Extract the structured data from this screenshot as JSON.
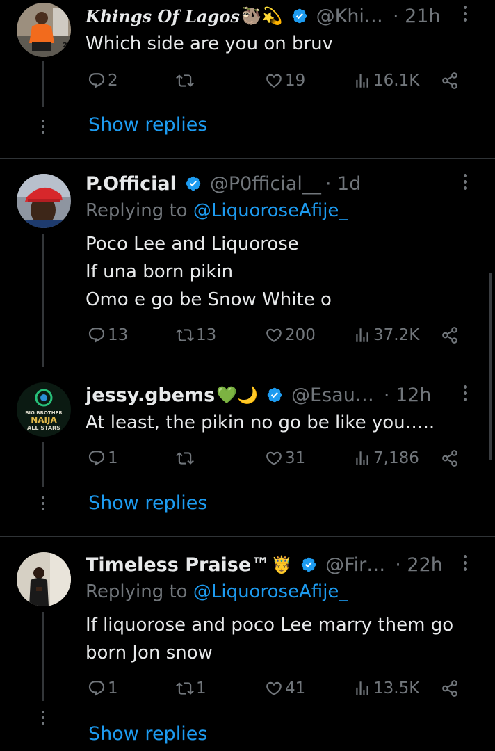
{
  "colors": {
    "background": "#000000",
    "text": "#e7e9ea",
    "muted": "#71767b",
    "accent": "#1d9bf0",
    "verified": "#1d9bf0"
  },
  "tweets": [
    {
      "name": "Khings Of Lagos",
      "name_emoji": "🦥💫",
      "handle": "@Khi…",
      "time": "· 21h",
      "replying_to": null,
      "lines": [
        "Which side are you on bruv"
      ],
      "replies": "2",
      "retweets": "",
      "likes": "19",
      "views": "16.1K",
      "show_replies": "Show replies"
    },
    {
      "name": "P.Official",
      "name_emoji": "",
      "handle": "@P0fficial__",
      "time": "· 1d",
      "replying_to_label": "Replying to",
      "replying_to": "@LiquoroseAfije_",
      "lines": [
        "Poco Lee and Liquorose",
        "If una born pikin",
        "Omo e go be Snow White o"
      ],
      "replies": "13",
      "retweets": "13",
      "likes": "200",
      "views": "37.2K"
    },
    {
      "name": "jessy.gbems",
      "name_emoji": "💚🌙",
      "handle": "@Esau…",
      "time": "· 12h",
      "avatar_text": [
        "BIG BROTHER",
        "NAIJA",
        "ALL STARS"
      ],
      "lines": [
        "At least, the pikin no go be like you….."
      ],
      "replies": "1",
      "retweets": "",
      "likes": "31",
      "views": "7,186",
      "show_replies": "Show replies"
    },
    {
      "name": "Timeless Praise™",
      "name_emoji": "🤴",
      "handle": "@Fir…",
      "time": "· 22h",
      "replying_to_label": "Replying to",
      "replying_to": "@LiquoroseAfije_",
      "lines": [
        "If liquorose and poco Lee marry them go",
        "born Jon snow"
      ],
      "replies": "1",
      "retweets": "1",
      "likes": "41",
      "views": "13.5K",
      "show_replies": "Show replies"
    }
  ]
}
